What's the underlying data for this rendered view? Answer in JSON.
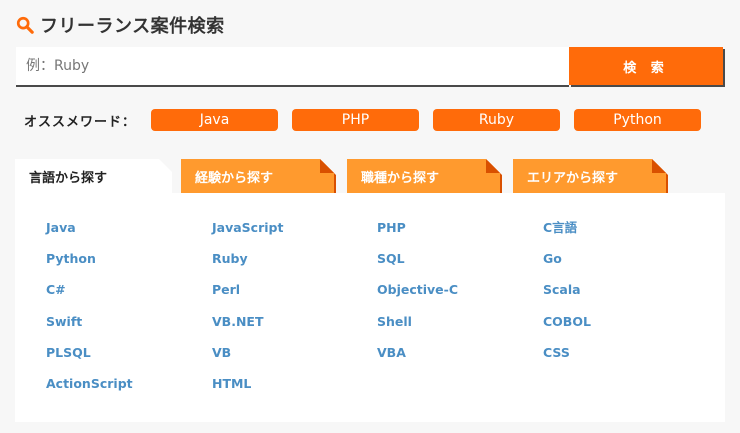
{
  "title": "フリーランス案件検索",
  "search": {
    "placeholder": "例：Ruby",
    "button_label": "検 索"
  },
  "keywords": {
    "label": "オススメワード：",
    "items": [
      "Java",
      "PHP",
      "Ruby",
      "Python"
    ]
  },
  "tabs": [
    {
      "label": "言語から探す",
      "active": true
    },
    {
      "label": "経験から探す",
      "active": false
    },
    {
      "label": "職種から探す",
      "active": false
    },
    {
      "label": "エリアから探す",
      "active": false
    }
  ],
  "languages": {
    "columns": [
      [
        "Java",
        "Python",
        "C#",
        "Swift",
        "PLSQL",
        "ActionScript"
      ],
      [
        "JavaScript",
        "Ruby",
        "Perl",
        "VB.NET",
        "VB",
        "HTML"
      ],
      [
        "PHP",
        "SQL",
        "Objective-C",
        "Shell",
        "VBA"
      ],
      [
        "C言語",
        "Go",
        "Scala",
        "COBOL",
        "CSS"
      ]
    ]
  },
  "colors": {
    "accent": "#ff6b0a",
    "tab_inactive": "#ff9a2e",
    "link": "#4a8ec4",
    "background": "#f7f7f7"
  }
}
